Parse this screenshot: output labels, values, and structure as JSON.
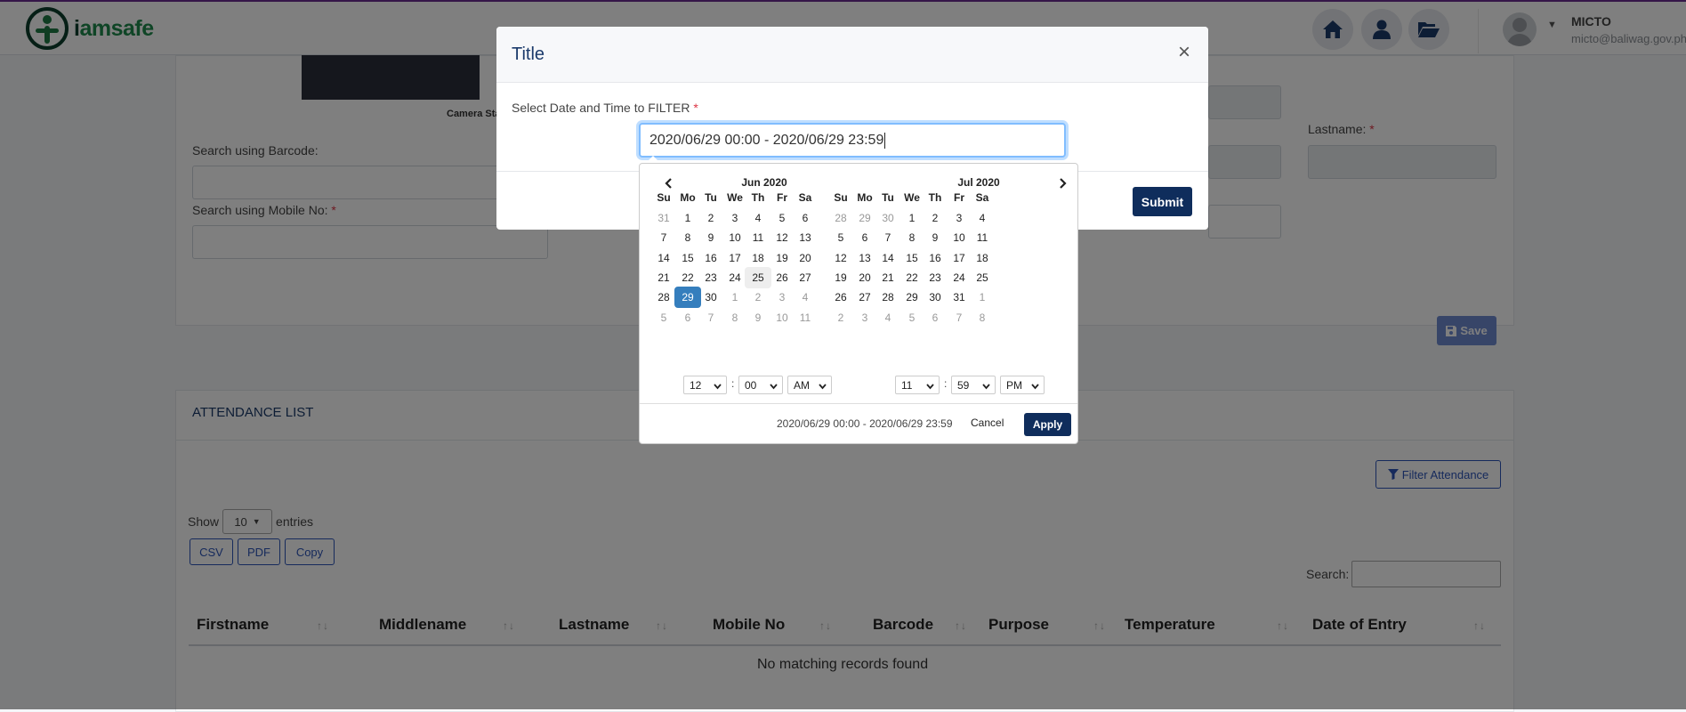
{
  "header": {
    "logo_prefix": "i",
    "logo_text": "amsafe",
    "user": {
      "name": "MICTO",
      "email": "micto@baliwag.gov.ph"
    }
  },
  "form": {
    "camera_label": "Camera Sta",
    "barcode_label": "Search using Barcode:",
    "mobile_label": "Search using Mobile No:",
    "lastname_label": "Lastname:",
    "required_mark": "*",
    "save_label": "Save"
  },
  "attendance": {
    "title": "ATTENDANCE LIST",
    "filter_label": "Filter Attendance",
    "show_label": "Show",
    "entries_value": "10",
    "entries_label": "entries",
    "export_buttons": [
      "CSV",
      "PDF",
      "Copy"
    ],
    "search_label": "Search:",
    "columns": [
      "Firstname",
      "Middlename",
      "Lastname",
      "Mobile No",
      "Barcode",
      "Purpose",
      "Temperature",
      "Date of Entry"
    ],
    "empty_text": "No matching records found"
  },
  "modal": {
    "title": "Title",
    "close_glyph": "×",
    "field_label": "Select Date and Time to FILTER",
    "required_mark": "*",
    "range_value": "2020/06/29 00:00 - 2020/06/29 23:59",
    "submit_label": "Submit"
  },
  "picker": {
    "weekdays": [
      "Su",
      "Mo",
      "Tu",
      "We",
      "Th",
      "Fr",
      "Sa"
    ],
    "left": {
      "title": "Jun 2020",
      "days": [
        [
          "31",
          "1",
          "2",
          "3",
          "4",
          "5",
          "6"
        ],
        [
          "7",
          "8",
          "9",
          "10",
          "11",
          "12",
          "13"
        ],
        [
          "14",
          "15",
          "16",
          "17",
          "18",
          "19",
          "20"
        ],
        [
          "21",
          "22",
          "23",
          "24",
          "25",
          "26",
          "27"
        ],
        [
          "28",
          "29",
          "30",
          "1",
          "2",
          "3",
          "4"
        ],
        [
          "5",
          "6",
          "7",
          "8",
          "9",
          "10",
          "11"
        ]
      ],
      "off": [
        [
          0,
          0
        ],
        [
          4,
          3
        ],
        [
          4,
          4
        ],
        [
          4,
          5
        ],
        [
          4,
          6
        ],
        [
          5,
          0
        ],
        [
          5,
          1
        ],
        [
          5,
          2
        ],
        [
          5,
          3
        ],
        [
          5,
          4
        ],
        [
          5,
          5
        ],
        [
          5,
          6
        ]
      ],
      "selected": [
        4,
        1
      ],
      "today": [
        3,
        4
      ],
      "time": {
        "hour": "12",
        "minute": "00",
        "ampm": "AM"
      }
    },
    "right": {
      "title": "Jul 2020",
      "days": [
        [
          "28",
          "29",
          "30",
          "1",
          "2",
          "3",
          "4"
        ],
        [
          "5",
          "6",
          "7",
          "8",
          "9",
          "10",
          "11"
        ],
        [
          "12",
          "13",
          "14",
          "15",
          "16",
          "17",
          "18"
        ],
        [
          "19",
          "20",
          "21",
          "22",
          "23",
          "24",
          "25"
        ],
        [
          "26",
          "27",
          "28",
          "29",
          "30",
          "31",
          "1"
        ],
        [
          "2",
          "3",
          "4",
          "5",
          "6",
          "7",
          "8"
        ]
      ],
      "off": [
        [
          0,
          0
        ],
        [
          0,
          1
        ],
        [
          0,
          2
        ],
        [
          4,
          6
        ],
        [
          5,
          0
        ],
        [
          5,
          1
        ],
        [
          5,
          2
        ],
        [
          5,
          3
        ],
        [
          5,
          4
        ],
        [
          5,
          5
        ],
        [
          5,
          6
        ]
      ],
      "time": {
        "hour": "11",
        "minute": "59",
        "ampm": "PM"
      }
    },
    "time_separator": ":",
    "range_text": "2020/06/29 00:00 - 2020/06/29 23:59",
    "cancel_label": "Cancel",
    "apply_label": "Apply"
  },
  "colors": {
    "brand_navy": "#0f2d5c",
    "brand_green": "#1f8a4c",
    "selected_day": "#357ebd",
    "required": "#dc3545"
  }
}
